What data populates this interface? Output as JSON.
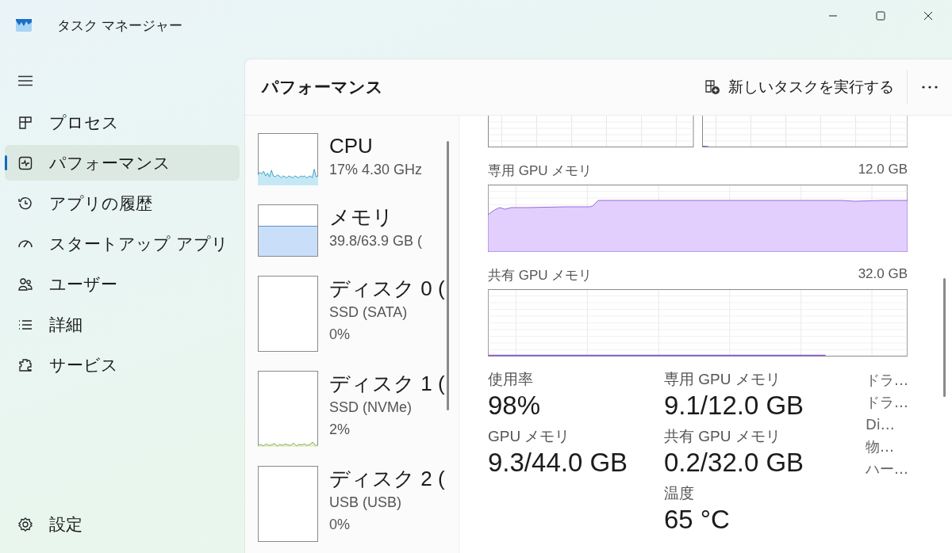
{
  "window": {
    "title": "タスク マネージャー"
  },
  "sidebar": {
    "items": [
      {
        "label": "プロセス",
        "selected": false
      },
      {
        "label": "パフォーマンス",
        "selected": true
      },
      {
        "label": "アプリの履歴",
        "selected": false
      },
      {
        "label": "スタートアップ アプリ",
        "selected": false
      },
      {
        "label": "ユーザー",
        "selected": false
      },
      {
        "label": "詳細",
        "selected": false
      },
      {
        "label": "サービス",
        "selected": false
      }
    ],
    "settings": "設定"
  },
  "header": {
    "title": "パフォーマンス",
    "new_task_button": "新しいタスクを実行する"
  },
  "devices": [
    {
      "kind": "cpu",
      "name": "CPU",
      "lines": [
        "17% 4.30 GHz"
      ]
    },
    {
      "kind": "memory",
      "name": "メモリ",
      "lines": [
        "39.8/63.9 GB ("
      ]
    },
    {
      "kind": "disk",
      "name": "ディスク 0 (",
      "lines": [
        "SSD (SATA)",
        "0%"
      ]
    },
    {
      "kind": "disk-active",
      "name": "ディスク 1 (",
      "lines": [
        "SSD (NVMe)",
        "2%"
      ]
    },
    {
      "kind": "disk",
      "name": "ディスク 2 (",
      "lines": [
        "USB (USB)",
        "0%"
      ]
    }
  ],
  "gpu_panel": {
    "charts": [
      {
        "kind": "dedicated",
        "label": "専用 GPU メモリ",
        "max": "12.0 GB"
      },
      {
        "kind": "shared",
        "label": "共有 GPU メモリ",
        "max": "32.0 GB"
      }
    ],
    "stat_columns": [
      [
        {
          "label": "使用率",
          "value": "98%"
        },
        {
          "label": "GPU メモリ",
          "value": "9.3/44.0 GB"
        }
      ],
      [
        {
          "label": "専用 GPU メモリ",
          "value": "9.1/12.0 GB"
        },
        {
          "label": "共有 GPU メモリ",
          "value": "0.2/32.0 GB"
        },
        {
          "label": "温度",
          "value": "65 °C"
        }
      ]
    ],
    "details": [
      "ドラ…",
      "ドラ…",
      "Di…",
      "物…",
      "ハー…"
    ]
  }
}
